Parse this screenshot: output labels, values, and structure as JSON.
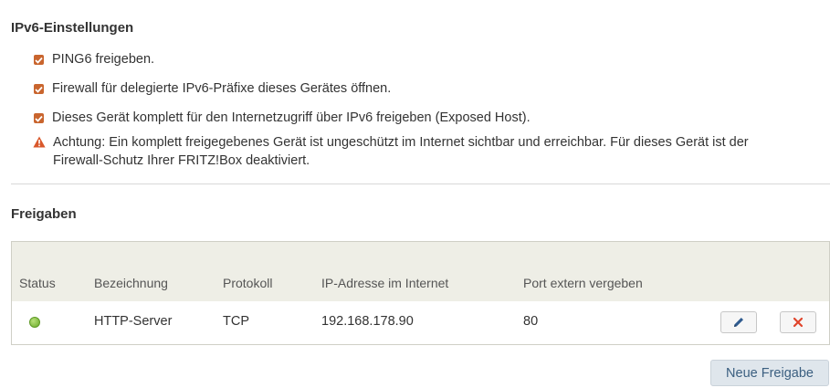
{
  "ipv6": {
    "title": "IPv6-Einstellungen",
    "options": [
      {
        "label": "PING6 freigeben.",
        "checked": true
      },
      {
        "label": "Firewall für delegierte IPv6-Präfixe dieses Gerätes öffnen.",
        "checked": true
      },
      {
        "label": "Dieses Gerät komplett für den Internetzugriff über IPv6 freigeben (Exposed Host).",
        "checked": true
      }
    ],
    "warning": "Achtung: Ein komplett freigegebenes Gerät ist ungeschützt im Internet sichtbar und erreichbar. Für dieses Gerät ist der Firewall-Schutz Ihrer FRITZ!Box deaktiviert."
  },
  "freigaben": {
    "title": "Freigaben",
    "columns": [
      "Status",
      "Bezeichnung",
      "Protokoll",
      "IP-Adresse im Internet",
      "Port extern vergeben"
    ],
    "rows": [
      {
        "status": "active",
        "name": "HTTP-Server",
        "protocol": "TCP",
        "ip": "192.168.178.90",
        "port": "80"
      }
    ],
    "new_button": "Neue Freigabe"
  },
  "colors": {
    "checkbox": "#c9652e",
    "warning": "#d9582b",
    "status_ok": "#6aaa2a",
    "edit_icon": "#2f5b8f",
    "delete_icon": "#e0442b"
  },
  "icons": {
    "checkbox": "checkmark-icon",
    "warning": "warning-triangle-icon",
    "edit": "pencil-icon",
    "delete": "x-icon"
  }
}
